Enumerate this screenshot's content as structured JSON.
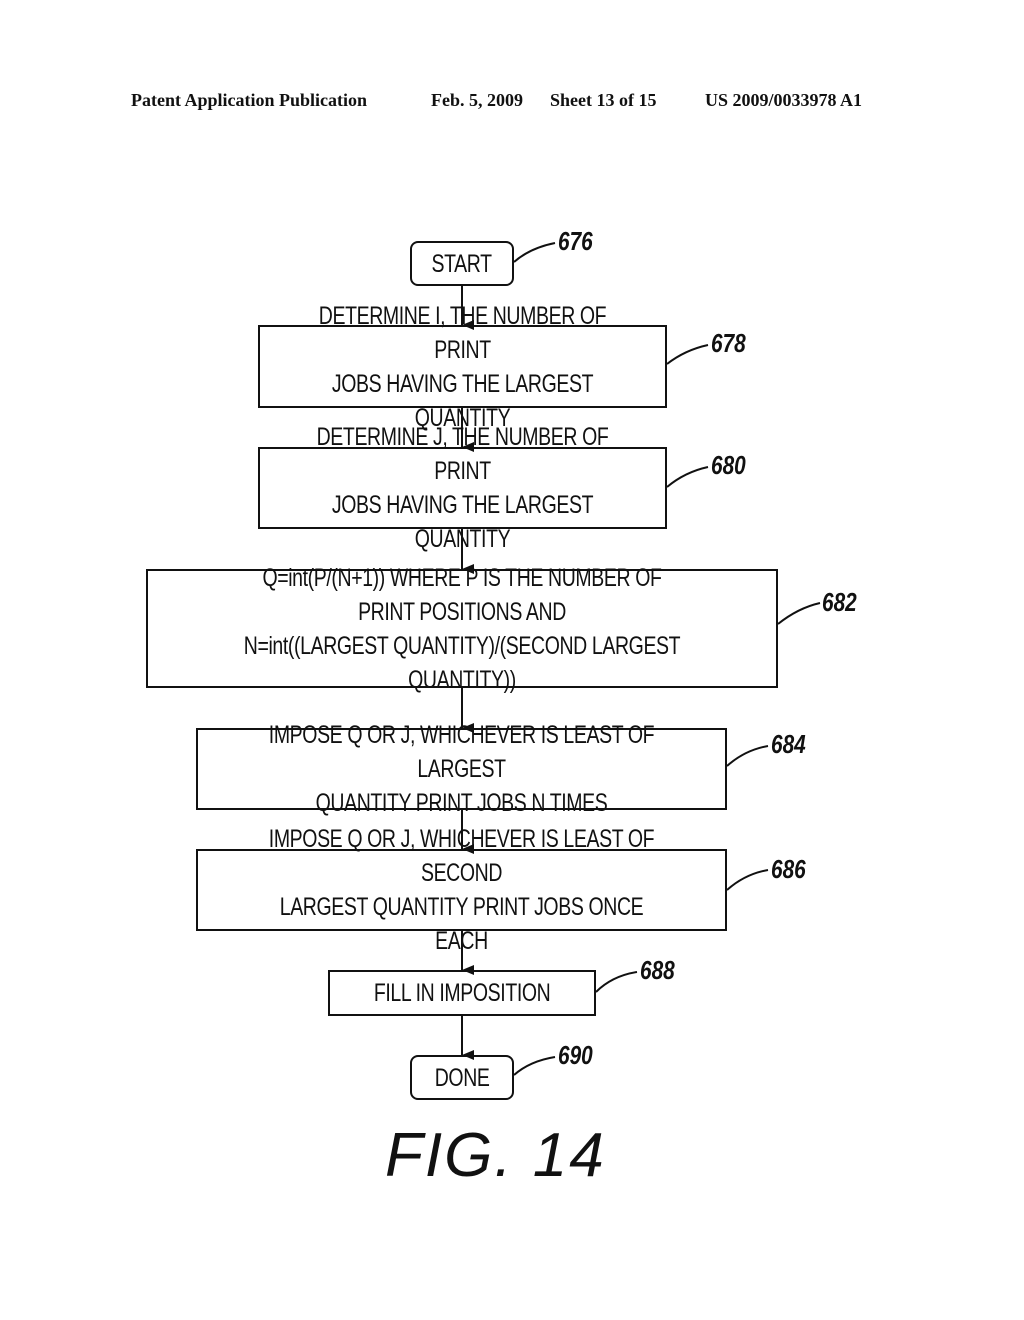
{
  "header": {
    "publication": "Patent Application Publication",
    "date": "Feb. 5, 2009",
    "sheet": "Sheet 13 of 15",
    "number": "US 2009/0033978 A1"
  },
  "flowchart": {
    "steps": [
      {
        "ref": "676",
        "text": "START",
        "shape": "terminal"
      },
      {
        "ref": "678",
        "text": "DETERMINE I, THE NUMBER OF PRINT\nJOBS HAVING THE LARGEST QUANTITY",
        "shape": "process"
      },
      {
        "ref": "680",
        "text": "DETERMINE J, THE NUMBER OF PRINT\nJOBS HAVING THE LARGEST QUANTITY",
        "shape": "process"
      },
      {
        "ref": "682",
        "text": "Q=int(P/(N+1)) WHERE P IS THE NUMBER OF\nPRINT POSITIONS AND\nN=int((LARGEST QUANTITY)/(SECOND LARGEST QUANTITY))",
        "shape": "process"
      },
      {
        "ref": "684",
        "text": "IMPOSE Q OR J, WHICHEVER IS LEAST OF LARGEST\nQUANTITY PRINT JOBS N TIMES",
        "shape": "process"
      },
      {
        "ref": "686",
        "text": "IMPOSE Q OR J, WHICHEVER IS LEAST OF SECOND\nLARGEST QUANTITY PRINT JOBS ONCE EACH",
        "shape": "process"
      },
      {
        "ref": "688",
        "text": "FILL IN IMPOSITION",
        "shape": "process"
      },
      {
        "ref": "690",
        "text": "DONE",
        "shape": "terminal"
      }
    ]
  },
  "figure_label": "FIG. 14"
}
